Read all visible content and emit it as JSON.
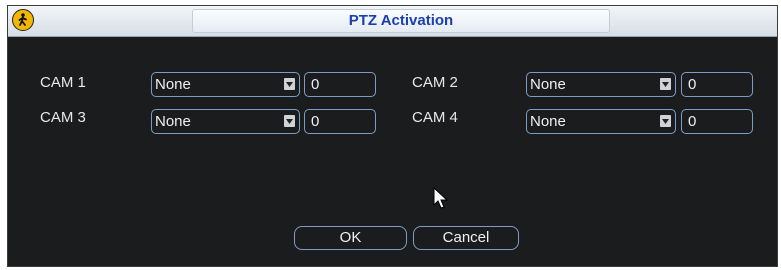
{
  "window": {
    "title": "PTZ Activation",
    "icon": "pedestrian-icon"
  },
  "rows": [
    {
      "label": "CAM 1",
      "select": "None",
      "value": "0"
    },
    {
      "label": "CAM 2",
      "select": "None",
      "value": "0"
    },
    {
      "label": "CAM 3",
      "select": "None",
      "value": "0"
    },
    {
      "label": "CAM 4",
      "select": "None",
      "value": "0"
    }
  ],
  "buttons": {
    "ok": "OK",
    "cancel": "Cancel"
  },
  "colors": {
    "dialog_bg": "#1b1c1e",
    "title_text": "#1a3fb0",
    "field_border": "#7d9dc4",
    "icon_bg": "#f2b705"
  }
}
